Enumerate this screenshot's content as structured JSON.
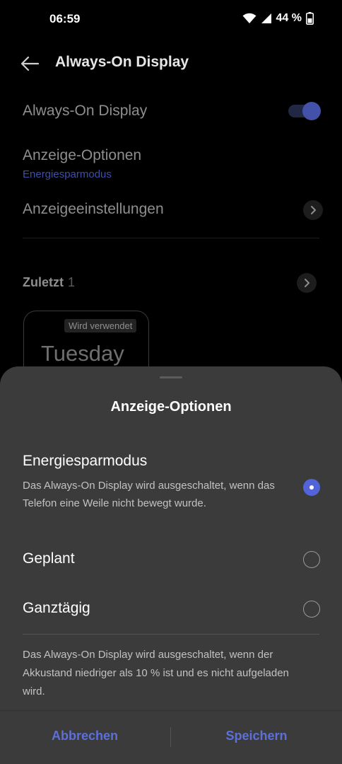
{
  "status_bar": {
    "time": "06:59",
    "battery_percent": "44 %"
  },
  "app_bar": {
    "title": "Always-On Display"
  },
  "settings": {
    "aod_label": "Always-On Display",
    "aod_enabled": true,
    "display_options_label": "Anzeige-Optionen",
    "display_options_value": "Energiesparmodus",
    "display_settings_label": "Anzeigeeinstellungen",
    "recent_label": "Zuletzt",
    "recent_count": "1",
    "preview_badge": "Wird verwendet",
    "preview_day": "Tuesday"
  },
  "sheet": {
    "title": "Anzeige-Optionen",
    "options": [
      {
        "label": "Energiesparmodus",
        "description": "Das Always-On Display wird ausgeschaltet, wenn das Telefon eine Weile nicht bewegt wurde.",
        "selected": true
      },
      {
        "label": "Geplant",
        "selected": false
      },
      {
        "label": "Ganztägig",
        "selected": false
      }
    ],
    "footer_note": "Das Always-On Display wird ausgeschaltet, wenn der Akkustand niedriger als 10 % ist und es nicht aufgeladen wird.",
    "cancel_label": "Abbrechen",
    "save_label": "Speichern"
  },
  "colors": {
    "accent": "#5264d8",
    "sheet_background": "#3b3b3b",
    "background": "#000000"
  },
  "icons": {
    "back": "arrow-left-icon",
    "wifi": "wifi-icon",
    "signal": "signal-icon",
    "battery": "battery-icon",
    "chevron": "chevron-right-icon"
  }
}
